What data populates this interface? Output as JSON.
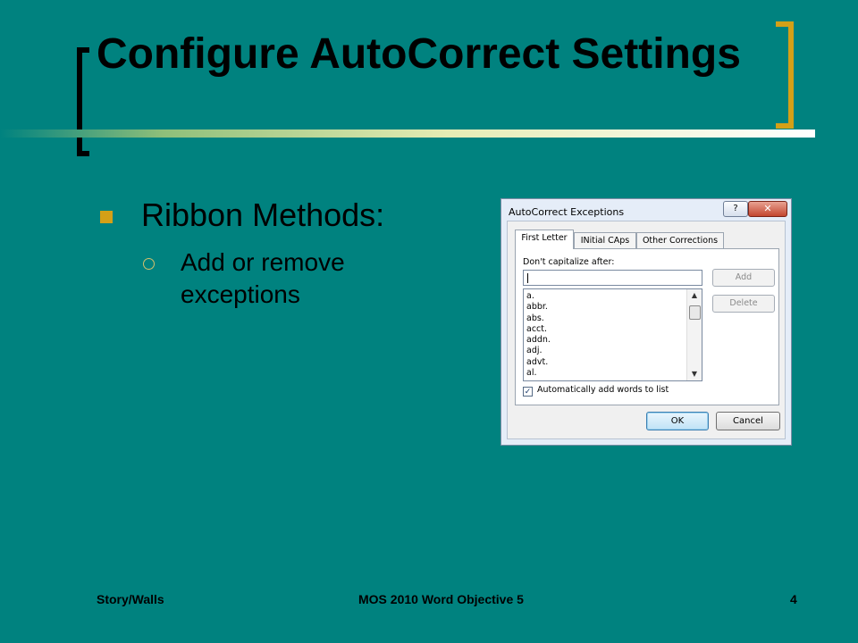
{
  "slide": {
    "title": "Configure AutoCorrect Settings",
    "bullets": [
      {
        "text": "Ribbon Methods:"
      },
      {
        "text": "Add or remove exceptions"
      }
    ],
    "footer": {
      "left": "Story/Walls",
      "center": "MOS 2010 Word Objective 5",
      "page_number": "4"
    }
  },
  "dialog": {
    "title": "AutoCorrect Exceptions",
    "help_label": "?",
    "close_label": "✕",
    "tabs": [
      {
        "label": "First Letter",
        "active": true
      },
      {
        "label": "INitial CAps",
        "active": false
      },
      {
        "label": "Other Corrections",
        "active": false
      }
    ],
    "dont_capitalize_label": "Don't capitalize after:",
    "input_value": "",
    "add_label": "Add",
    "delete_label": "Delete",
    "list_items": [
      "a.",
      "abbr.",
      "abs.",
      "acct.",
      "addn.",
      "adj.",
      "advt.",
      "al."
    ],
    "auto_add_label": "Automatically add words to list",
    "auto_add_checked": true,
    "ok_label": "OK",
    "cancel_label": "Cancel",
    "checkmark": "✓",
    "scroll_up": "▲",
    "scroll_down": "▼"
  },
  "colors": {
    "background": "#00827f",
    "accent_gold": "#d4a017"
  }
}
